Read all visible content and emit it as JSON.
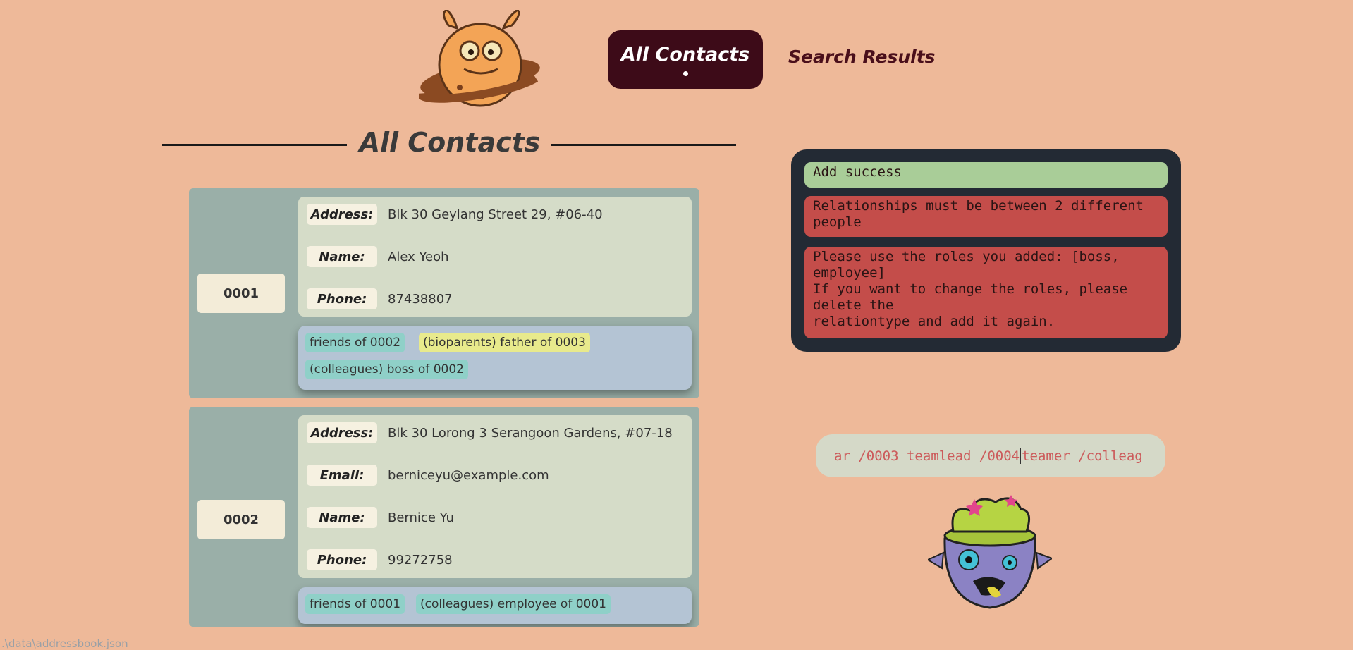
{
  "nav": {
    "active_label": "All Contacts",
    "other_label": "Search Results"
  },
  "section_title": "All Contacts",
  "contacts": [
    {
      "id": "0001",
      "fields": [
        {
          "key": "Address:",
          "value": "Blk 30 Geylang Street 29, #06-40"
        },
        {
          "key": "Name:",
          "value": "Alex Yeoh"
        },
        {
          "key": "Phone:",
          "value": "87438807"
        }
      ],
      "tags": [
        {
          "text": "friends of 0002",
          "color": "teal"
        },
        {
          "text": "(bioparents) father of 0003",
          "color": "yellow"
        },
        {
          "text": "(colleagues) boss of 0002",
          "color": "teal"
        }
      ]
    },
    {
      "id": "0002",
      "fields": [
        {
          "key": "Address:",
          "value": "Blk 30 Lorong 3 Serangoon Gardens, #07-18"
        },
        {
          "key": "Email:",
          "value": "berniceyu@example.com"
        },
        {
          "key": "Name:",
          "value": "Bernice Yu"
        },
        {
          "key": "Phone:",
          "value": "99272758"
        }
      ],
      "tags": [
        {
          "text": "friends of 0001",
          "color": "teal"
        },
        {
          "text": "(colleagues) employee of 0001",
          "color": "teal"
        }
      ]
    }
  ],
  "results": {
    "success": "Add success",
    "error1": "Relationships must be between 2 different people",
    "error2_line1": "Please use the roles you added: [boss, employee]",
    "error2_line2": "If you want to change the roles, please delete the",
    "error2_line3": "relationtype and add it again."
  },
  "command": {
    "before_caret": "ar /0003 teamlead /0004",
    "after_caret": " teamer /colleag"
  },
  "footer_path": ".\\data\\addressbook.json",
  "colors": {
    "background": "#eeb999",
    "nav_active": "#3d0b18",
    "card": "#9aafa8",
    "success": "#a9cd98",
    "error": "#c44d4a",
    "panel": "#232a34"
  }
}
